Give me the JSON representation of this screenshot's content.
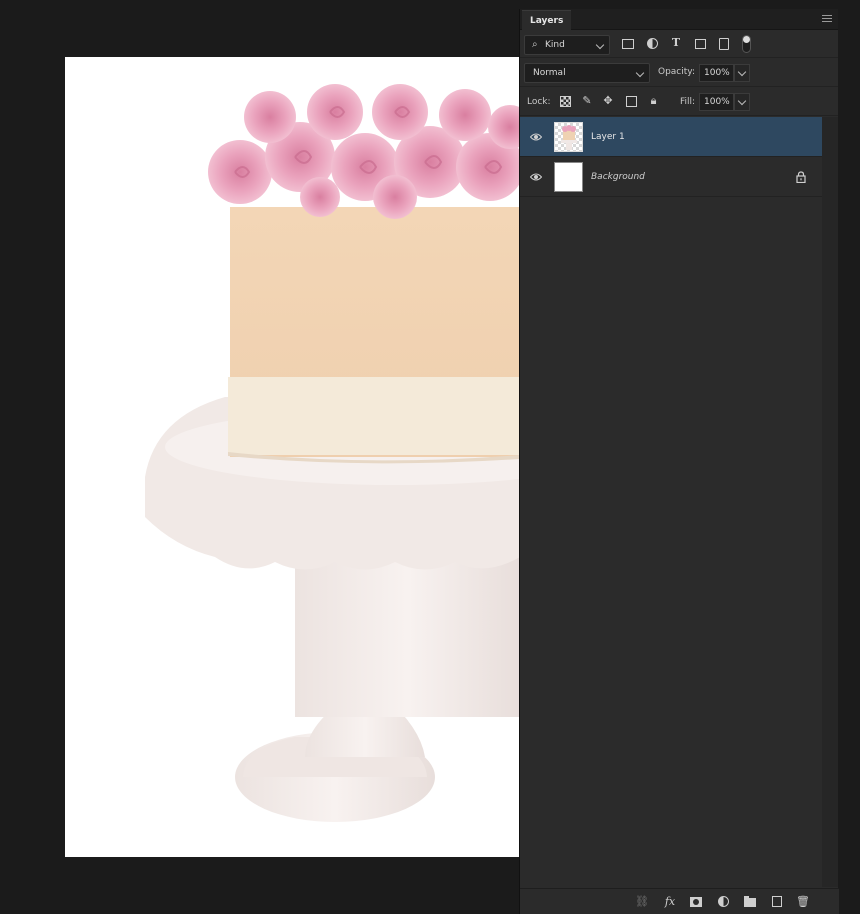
{
  "panel": {
    "tab_label": "Layers",
    "filter": {
      "label": "Kind",
      "icon": "search-icon"
    },
    "filter_icons": [
      "image-filter-icon",
      "adjustment-filter-icon",
      "type-filter-icon",
      "shape-filter-icon",
      "smart-object-filter-icon",
      "filter-toggle-icon"
    ],
    "blend_mode": "Normal",
    "opacity_label": "Opacity:",
    "opacity_value": "100%",
    "lock_label": "Lock:",
    "lock_icons": [
      "lock-transparent-pixels-icon",
      "lock-image-pixels-icon",
      "lock-position-icon",
      "lock-artboard-icon",
      "lock-all-icon"
    ],
    "fill_label": "Fill:",
    "fill_value": "100%"
  },
  "layers": [
    {
      "name": "Layer 1",
      "visible": true,
      "selected": true,
      "italic": false,
      "locked": false
    },
    {
      "name": "Background",
      "visible": true,
      "selected": false,
      "italic": true,
      "locked": true
    }
  ],
  "footer_icons": [
    "link-layers-icon",
    "fx-icon",
    "add-mask-icon",
    "adjustment-layer-icon",
    "new-group-icon",
    "new-layer-icon",
    "delete-layer-icon"
  ],
  "colors": {
    "selected_row": "#2e4860",
    "panel_bg": "#2b2b2b",
    "workspace_bg": "#1b1b1b"
  }
}
